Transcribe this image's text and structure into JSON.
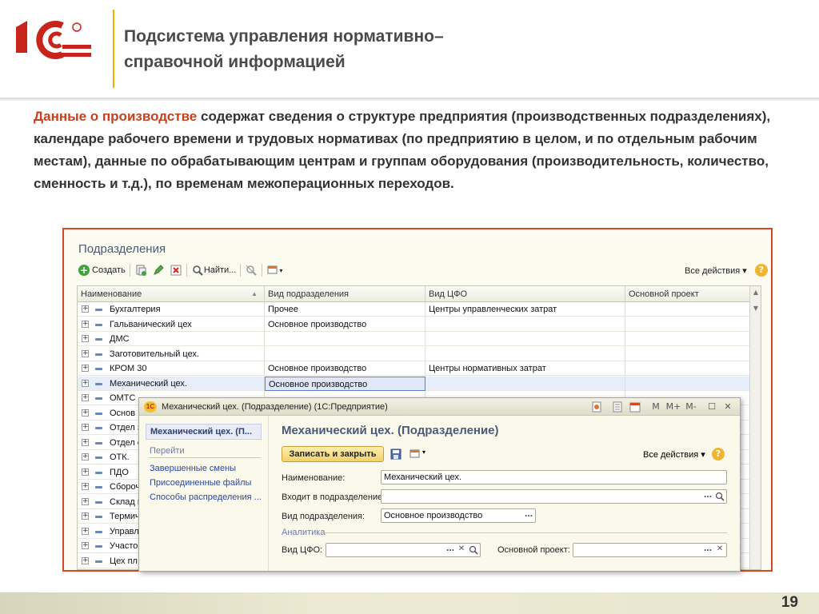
{
  "slide": {
    "title_line1": "Подсистема управления нормативно–",
    "title_line2": "справочной информацией",
    "intro_highlight": "Данные о производстве",
    "intro_text": " содержат сведения о структуре предприятия (производственных подразделениях), календаре рабочего времени и трудовых нормативах (по предприятию в целом, и по отдельным рабочим местам), данные по обрабатывающим центрам и группам оборудования (производительность, количество, сменность и т.д.), по временам межоперационных переходов.",
    "page_number": "19",
    "colors": {
      "accent": "#c8401d",
      "logo_red": "#c7251b",
      "frame_border": "#d04a26",
      "divider": "#e9b400"
    }
  },
  "list": {
    "title": "Подразделения",
    "toolbar": {
      "create_label": "Создать",
      "find_label": "Найти...",
      "all_actions_label": "Все действия ▾",
      "help": "?"
    },
    "columns": [
      "Наименование",
      "Вид подразделения",
      "Вид ЦФО",
      "Основной проект"
    ],
    "rows": [
      {
        "name": "Бухгалтерия",
        "kind": "Прочее",
        "cfo": "Центры управленческих затрат",
        "project": ""
      },
      {
        "name": "Гальванический цех",
        "kind": "Основное производство",
        "cfo": "",
        "project": ""
      },
      {
        "name": "ДМС",
        "kind": "",
        "cfo": "",
        "project": ""
      },
      {
        "name": "Заготовительный цех.",
        "kind": "",
        "cfo": "",
        "project": ""
      },
      {
        "name": "КРОМ 30",
        "kind": "Основное производство",
        "cfo": "Центры нормативных затрат",
        "project": ""
      },
      {
        "name": "Механический цех.",
        "kind": "Основное производство",
        "cfo": "",
        "project": ""
      },
      {
        "name": "ОМТС",
        "kind": "",
        "cfo": "",
        "project": ""
      },
      {
        "name": "Основ",
        "kind": "",
        "cfo": "",
        "project": ""
      },
      {
        "name": "Отдел з",
        "kind": "",
        "cfo": "",
        "project": ""
      },
      {
        "name": "Отдел с",
        "kind": "",
        "cfo": "",
        "project": ""
      },
      {
        "name": "ОТК.",
        "kind": "",
        "cfo": "",
        "project": ""
      },
      {
        "name": "ПДО",
        "kind": "",
        "cfo": "",
        "project": ""
      },
      {
        "name": "Сборочн",
        "kind": "",
        "cfo": "",
        "project": ""
      },
      {
        "name": "Склад г",
        "kind": "",
        "cfo": "",
        "project": ""
      },
      {
        "name": "Термич",
        "kind": "",
        "cfo": "",
        "project": ""
      },
      {
        "name": "Управл",
        "kind": "",
        "cfo": "",
        "project": ""
      },
      {
        "name": "Участо",
        "kind": "",
        "cfo": "",
        "project": ""
      },
      {
        "name": "Цех пл",
        "kind": "",
        "cfo": "",
        "project": ""
      }
    ]
  },
  "dialog": {
    "window_title": "Механический цех. (Подразделение)  (1С:Предприятие)",
    "logo_text": "1С",
    "titlebar_buttons": [
      "M",
      "M+",
      "M-"
    ],
    "nav": {
      "current": "Механический цех. (П...",
      "goto_label": "Перейти",
      "links": [
        "Завершенные смены",
        "Присоединенные файлы",
        "Способы распределения ..."
      ]
    },
    "form_title": "Механический цех. (Подразделение)",
    "save_close_label": "Записать и закрыть",
    "all_actions_label": "Все действия ▾",
    "help": "?",
    "fields": {
      "name_label": "Наименование:",
      "name_value": "Механический цех.",
      "parent_label": "Входит в подразделение:",
      "parent_value": "",
      "kind_label": "Вид подразделения:",
      "kind_value": "Основное производство",
      "analytics_label": "Аналитика",
      "cfo_label": "Вид ЦФО:",
      "cfo_value": "",
      "project_label": "Основной проект:",
      "project_value": ""
    }
  }
}
